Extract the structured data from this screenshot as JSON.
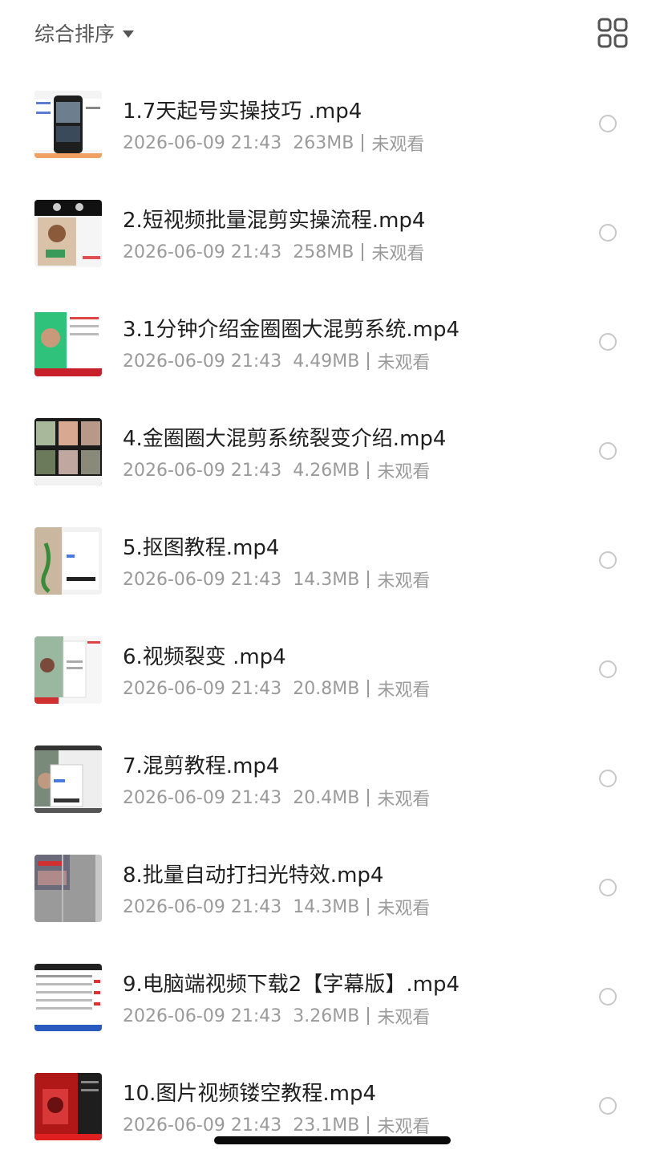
{
  "header": {
    "sort_label": "综合排序",
    "sort_caret_icon": "caret-down-icon",
    "view_toggle_icon": "grid-view-icon"
  },
  "colors": {
    "title": "#1f1f1f",
    "meta": "#9a9a9a",
    "radio_border": "#c8c8c8"
  },
  "files": [
    {
      "title": "1.7天起号实操技巧 .mp4",
      "date": "2026-06-09 21:43",
      "size": "263MB",
      "status": "未观看"
    },
    {
      "title": "2.短视频批量混剪实操流程.mp4",
      "date": "2026-06-09 21:43",
      "size": "258MB",
      "status": "未观看"
    },
    {
      "title": "3.1分钟介绍金圈圈大混剪系统.mp4",
      "date": "2026-06-09 21:43",
      "size": "4.49MB",
      "status": "未观看"
    },
    {
      "title": "4.金圈圈大混剪系统裂变介绍.mp4",
      "date": "2026-06-09 21:43",
      "size": "4.26MB",
      "status": "未观看"
    },
    {
      "title": "5.抠图教程.mp4",
      "date": "2026-06-09 21:43",
      "size": "14.3MB",
      "status": "未观看"
    },
    {
      "title": "6.视频裂变 .mp4",
      "date": "2026-06-09 21:43",
      "size": "20.8MB",
      "status": "未观看"
    },
    {
      "title": "7.混剪教程.mp4",
      "date": "2026-06-09 21:43",
      "size": "20.4MB",
      "status": "未观看"
    },
    {
      "title": "8.批量自动打扫光特效.mp4",
      "date": "2026-06-09 21:43",
      "size": "14.3MB",
      "status": "未观看"
    },
    {
      "title": "9.电脑端视频下载2【字幕版】.mp4",
      "date": "2026-06-09 21:43",
      "size": "3.26MB",
      "status": "未观看"
    },
    {
      "title": "10.图片视频镂空教程.mp4",
      "date": "2026-06-09 21:43",
      "size": "23.1MB",
      "status": "未观看"
    }
  ]
}
